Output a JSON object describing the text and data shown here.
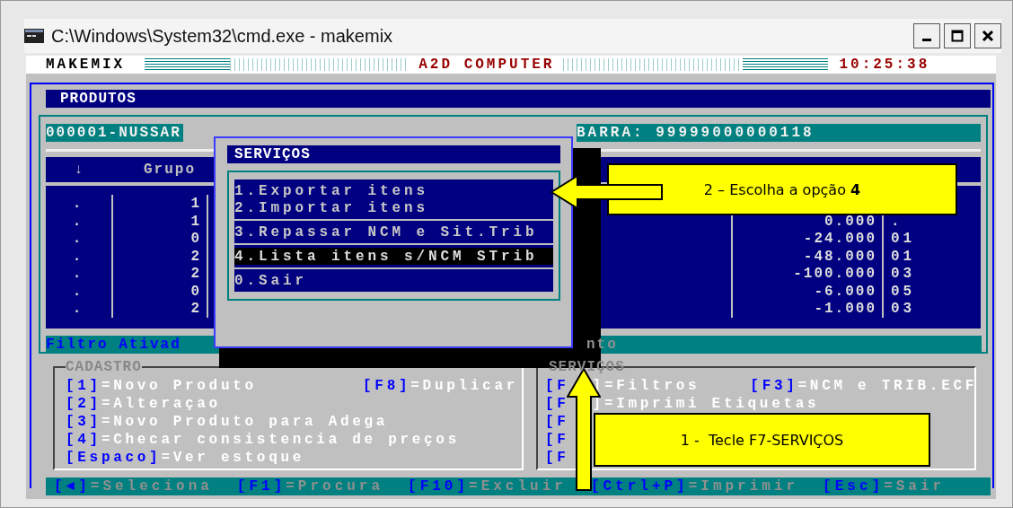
{
  "window": {
    "title": "C:\\Windows\\System32\\cmd.exe - makemix"
  },
  "header": {
    "app": "MAKEMIX",
    "company": "A2D COMPUTER",
    "time": "10:25:38"
  },
  "screen_title": "PRODUTOS",
  "product": {
    "code": "000001-NUSSAR",
    "barcode": "BARRA: 99999000000118"
  },
  "table": {
    "columns": [
      "↓",
      "Grupo"
    ],
    "rows": [
      {
        "column_1": ".",
        "column_2": "1"
      },
      {
        "column_1": ".",
        "column_2": "1",
        "column_3": "0.000",
        "column_4": "."
      },
      {
        "column_1": ".",
        "column_2": "0",
        "column_3": "-24.000",
        "column_4": "01"
      },
      {
        "column_1": ".",
        "column_2": "2",
        "column_3": "-48.000",
        "column_4": "01"
      },
      {
        "column_1": ".",
        "column_2": "2",
        "column_3": "-100.000",
        "column_4": "03"
      },
      {
        "column_1": ".",
        "column_2": "0",
        "column_3": "-6.000",
        "column_4": "05"
      },
      {
        "column_1": ".",
        "column_2": "2",
        "column_3": "-1.000",
        "column_4": "03"
      }
    ]
  },
  "filter_bar": {
    "text": "Filtro Ativad",
    "tail": "nto"
  },
  "cadastro": {
    "title": "CADASTRO",
    "lines": [
      [
        {
          "key": "[1]",
          "label": "=Novo Produto"
        },
        {
          "key": "[F8]",
          "label": "=Duplicar"
        }
      ],
      [
        {
          "key": "[2]",
          "label": "=Alteraçao"
        }
      ],
      [
        {
          "key": "[3]",
          "label": "=Novo Produto para Adega"
        }
      ],
      [
        {
          "key": "[4]",
          "label": "=Checar consistencia de preços"
        }
      ],
      [
        {
          "key": "[Espaco]",
          "label": "=Ver estoque"
        }
      ]
    ]
  },
  "servicos": {
    "title": "SERVIÇOS",
    "lines": [
      [
        {
          "key": "[F",
          "label": "]=Filtros"
        },
        {
          "key": "[F3]",
          "label": "=NCM e TRIB.ECF"
        }
      ],
      [
        {
          "key": "[F",
          "label": "]=Imprimi Etiquetas"
        }
      ],
      [
        {
          "key": "[F"
        }
      ],
      [
        {
          "key": "[F"
        }
      ],
      [
        {
          "key": "[F"
        }
      ]
    ]
  },
  "status_bar": [
    {
      "key": "[◄]",
      "label": "=Seleciona"
    },
    {
      "key": "[F1]",
      "label": "=Procura"
    },
    {
      "key": "[F10]",
      "label": "=Excluir"
    },
    {
      "key": "[Ctrl+P]",
      "label": "=Imprimir"
    },
    {
      "key": "[Esc]",
      "label": "=Sair"
    }
  ],
  "menu": {
    "title": "SERVIÇOS",
    "groups": [
      [
        {
          "label": "1.Exportar itens",
          "selected": false
        },
        {
          "label": "2.Importar itens",
          "selected": false
        }
      ],
      [
        {
          "label": "3.Repassar NCM e Sit.Trib",
          "selected": false
        }
      ],
      [
        {
          "label": "4.Lista itens s/NCM STrib",
          "selected": true
        }
      ],
      [
        {
          "label": "0.Sair",
          "selected": false
        }
      ]
    ]
  },
  "callouts": [
    {
      "text": "2 – Escolha a opção **4**",
      "kind": "left"
    },
    {
      "text": "1 -  Tecle F7-SERVIÇOS",
      "kind": "up"
    }
  ]
}
